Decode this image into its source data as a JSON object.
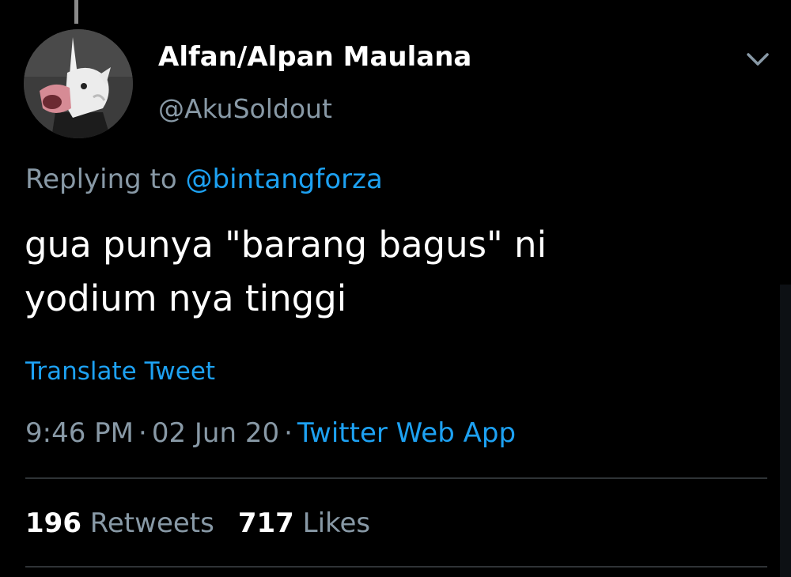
{
  "tweet": {
    "author": {
      "display_name": "Alfan/Alpan Maulana",
      "handle": "@AkuSoldout",
      "avatar_icon": "unicorn-mask-avatar"
    },
    "replying_label": "Replying to",
    "replying_to": "@bintangforza",
    "text": "gua punya \"barang bagus\" ni\nyodium nya tinggi",
    "translate_label": "Translate Tweet",
    "time": "9:46 PM",
    "date": "02 Jun 20",
    "separator": "·",
    "source": "Twitter Web App",
    "retweets_count": "196",
    "retweets_label": "Retweets",
    "likes_count": "717",
    "likes_label": "Likes",
    "more_icon": "chevron-down-icon"
  },
  "colors": {
    "background": "#000000",
    "primary_text": "#ffffff",
    "secondary_text": "#8899a6",
    "accent": "#1da1f2",
    "divider": "#2f3336"
  }
}
